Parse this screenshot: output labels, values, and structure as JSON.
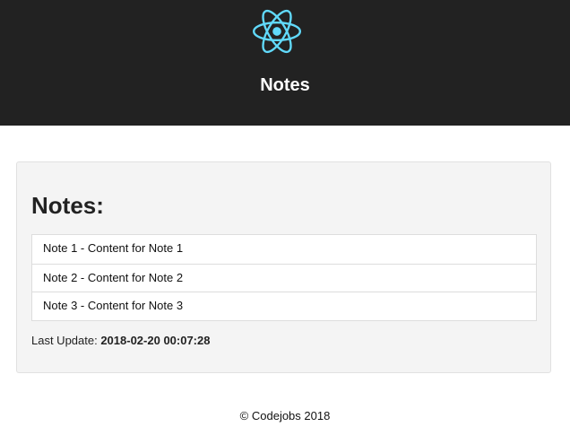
{
  "header": {
    "logo_icon": "react-atom-logo-icon",
    "logo_color": "#61dafb",
    "title": "Notes",
    "background": "#222222"
  },
  "main": {
    "heading": "Notes:",
    "notes": [
      {
        "text": "Note 1 - Content for Note 1"
      },
      {
        "text": "Note 2 - Content for Note 2"
      },
      {
        "text": "Note 3 - Content for Note 3"
      }
    ],
    "last_update_label": "Last Update:",
    "last_update_value": "2018-02-20 00:07:28"
  },
  "footer": {
    "text": "© Codejobs 2018"
  }
}
